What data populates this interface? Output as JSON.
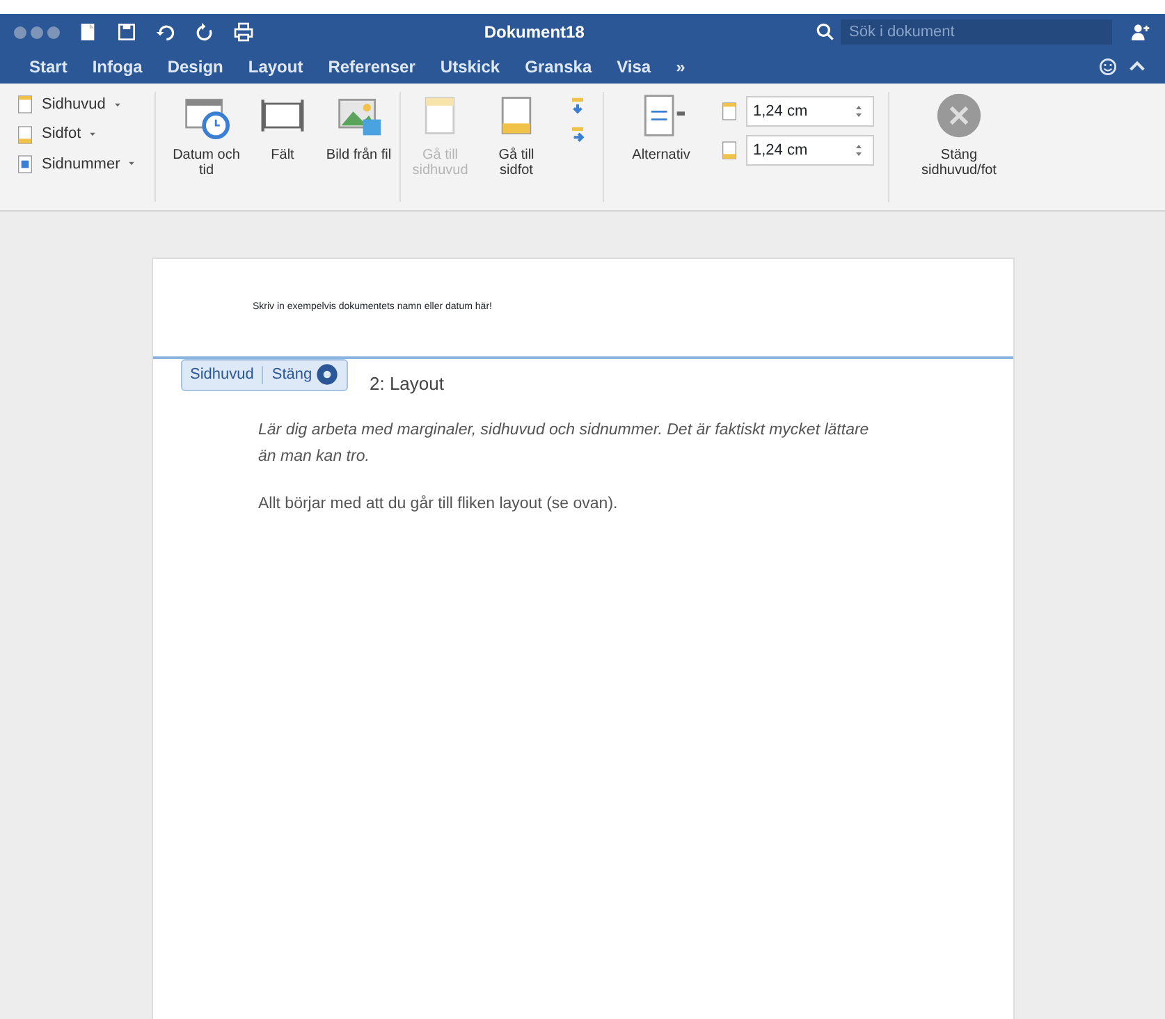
{
  "window": {
    "title": "Dokument18"
  },
  "search": {
    "placeholder": "Sök i dokument"
  },
  "tabs": [
    {
      "label": "Start",
      "selected": false
    },
    {
      "label": "Infoga",
      "selected": false
    },
    {
      "label": "Design",
      "selected": false
    },
    {
      "label": "Layout",
      "selected": false
    },
    {
      "label": "Referenser",
      "selected": false
    },
    {
      "label": "Utskick",
      "selected": false
    },
    {
      "label": "Granska",
      "selected": false
    },
    {
      "label": "Visa",
      "selected": false
    },
    {
      "label": "»",
      "selected": false
    }
  ],
  "ribbon": {
    "menus": [
      {
        "label": "Sidhuvud"
      },
      {
        "label": "Sidfot"
      },
      {
        "label": "Sidnummer"
      }
    ],
    "large_buttons": [
      {
        "label": "Datum och tid",
        "disabled": false
      },
      {
        "label": "Fält",
        "disabled": false
      },
      {
        "label": "Bild från fil",
        "disabled": false
      },
      {
        "label": "Gå till sidhuvud",
        "disabled": true
      },
      {
        "label": "Gå till sidfot",
        "disabled": false
      }
    ],
    "options": {
      "label": "Alternativ"
    },
    "spinners": [
      {
        "value": "1,24 cm"
      },
      {
        "value": "1,24 cm"
      }
    ],
    "close": {
      "label": "Stäng sidhuvud/fot"
    }
  },
  "document": {
    "header_text": "Skriv in exempelvis dokumentets namn eller datum här!",
    "header_tag": {
      "label": "Sidhuvud",
      "close": "Stäng"
    },
    "heading": "2: Layout",
    "paragraphs": [
      {
        "text": "Lär dig arbeta med marginaler, sidhuvud och sidnummer. Det är faktiskt mycket lättare än man kan tro.",
        "italic": true
      },
      {
        "text": "Allt börjar med att du går till fliken layout (se ovan).",
        "italic": false
      }
    ]
  }
}
